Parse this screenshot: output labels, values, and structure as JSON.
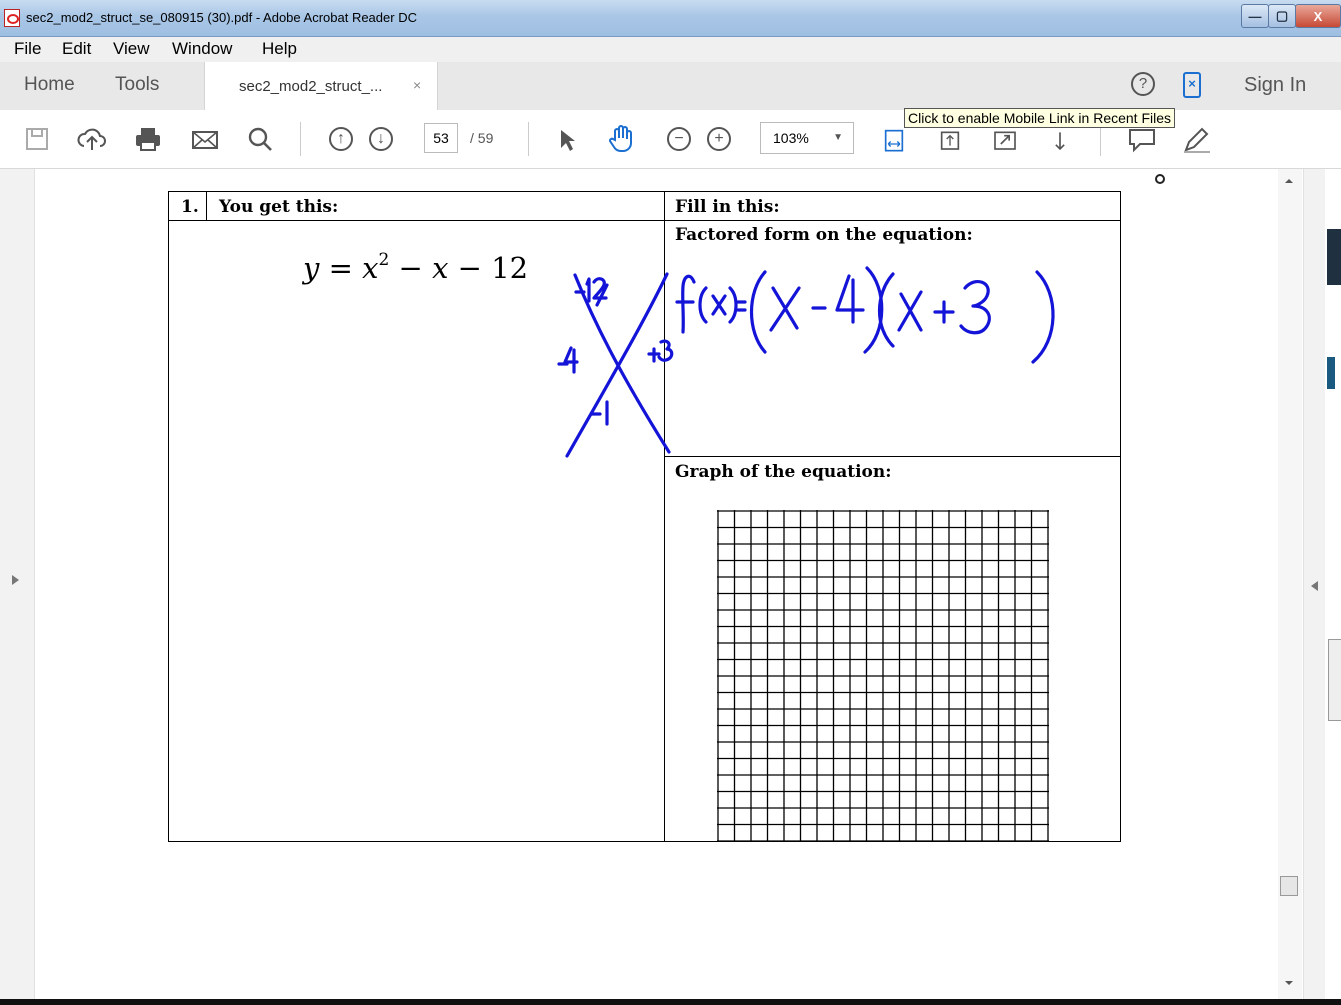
{
  "window": {
    "title": "sec2_mod2_struct_se_080915 (30).pdf - Adobe Acrobat Reader DC",
    "min_label": "—",
    "max_label": "▢",
    "close_label": "X"
  },
  "menu": [
    "File",
    "Edit",
    "View",
    "Window",
    "Help"
  ],
  "tabs": {
    "home": "Home",
    "tools": "Tools",
    "document": "sec2_mod2_struct_...",
    "document_close": "×"
  },
  "header_right": {
    "help": "?",
    "mobile": "×",
    "sign_in": "Sign In"
  },
  "tooltip": "Click to enable Mobile Link in Recent Files",
  "toolbar": {
    "page_current": "53",
    "page_total": "/ 59",
    "zoom": "103%",
    "zoom_caret": "▼",
    "zoom_out": "−",
    "zoom_in": "+",
    "prev_page": "↑",
    "next_page": "↓"
  },
  "document": {
    "problem_number": "1.",
    "left_header": "You get this:",
    "right_header": "Fill in this:",
    "factored_label": "Factored form on the equation:",
    "graph_label": "Graph of the equation:",
    "equation": {
      "lhs": "y",
      "eq": "=",
      "x": "x",
      "exp": "2",
      "minus1": "−",
      "x2": "x",
      "minus2": "−",
      "const": "12"
    }
  },
  "handwriting": {
    "color": "#1414d8",
    "factored": "f(x)=(x-4)(x+3)",
    "diamond_top": "-12",
    "diamond_left": "-4",
    "diamond_right": "+3",
    "diamond_bottom": "-1"
  }
}
